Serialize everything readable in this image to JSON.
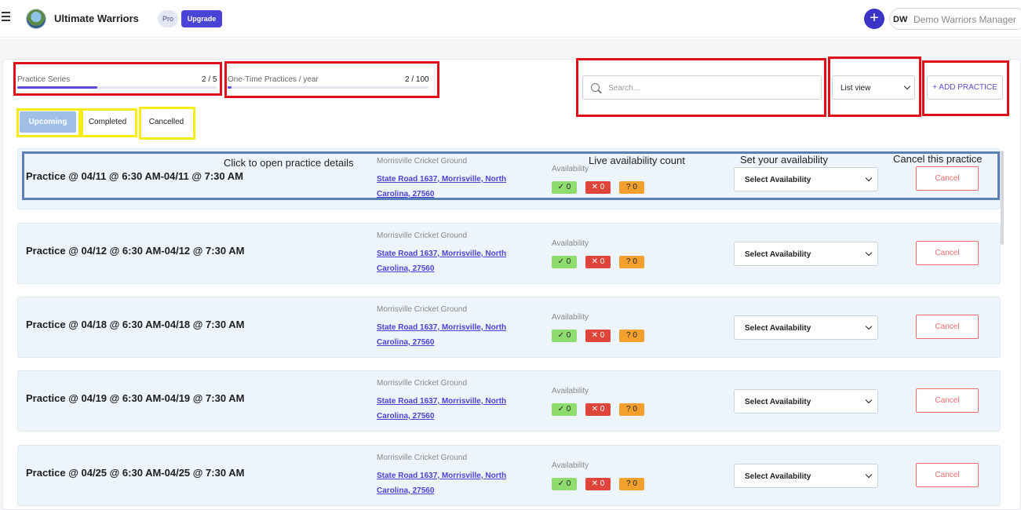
{
  "header": {
    "team_name": "Ultimate Warriors",
    "pro_badge": "Pro",
    "upgrade_label": "Upgrade",
    "add_icon": "+",
    "user_initials": "DW",
    "user_name": "Demo Warriors Manager"
  },
  "stats": {
    "practice_series": {
      "label": "Practice Series",
      "count": "2 / 5",
      "progress": 0.4
    },
    "one_time": {
      "label": "One-Time Practices / year",
      "count": "2 / 100",
      "progress": 0.02
    }
  },
  "toolbar": {
    "search_placeholder": "Search...",
    "view_select": "List view",
    "add_practice_label": "+ ADD PRACTICE"
  },
  "tabs": [
    {
      "label": "Upcoming",
      "active": true
    },
    {
      "label": "Completed",
      "active": false
    },
    {
      "label": "Cancelled",
      "active": false
    }
  ],
  "practices": [
    {
      "title": "Practice @ 04/11 @ 6:30 AM-04/11 @ 7:30 AM",
      "venue": "Morrisville Cricket Ground",
      "address_line1": "State Road 1637, Morrisville, North",
      "address_line2": "Carolina, 27560",
      "availability_label": "Availability",
      "yes": "✓ 0",
      "no": "✕ 0",
      "maybe": "? 0",
      "select_label": "Select Availability",
      "cancel_label": "Cancel"
    },
    {
      "title": "Practice @ 04/12 @ 6:30 AM-04/12 @ 7:30 AM",
      "venue": "Morrisville Cricket Ground",
      "address_line1": "State Road 1637, Morrisville, North",
      "address_line2": "Carolina, 27560",
      "availability_label": "Availability",
      "yes": "✓ 0",
      "no": "✕ 0",
      "maybe": "? 0",
      "select_label": "Select Availability",
      "cancel_label": "Cancel"
    },
    {
      "title": "Practice @ 04/18 @ 6:30 AM-04/18 @ 7:30 AM",
      "venue": "Morrisville Cricket Ground",
      "address_line1": "State Road 1637, Morrisville, North",
      "address_line2": "Carolina, 27560",
      "availability_label": "Availability",
      "yes": "✓ 0",
      "no": "✕ 0",
      "maybe": "? 0",
      "select_label": "Select Availability",
      "cancel_label": "Cancel"
    },
    {
      "title": "Practice @ 04/19 @ 6:30 AM-04/19 @ 7:30 AM",
      "venue": "Morrisville Cricket Ground",
      "address_line1": "State Road 1637, Morrisville, North",
      "address_line2": "Carolina, 27560",
      "availability_label": "Availability",
      "yes": "✓ 0",
      "no": "✕ 0",
      "maybe": "? 0",
      "select_label": "Select Availability",
      "cancel_label": "Cancel"
    },
    {
      "title": "Practice @ 04/25 @ 6:30 AM-04/25 @ 7:30 AM",
      "venue": "Morrisville Cricket Ground",
      "address_line1": "State Road 1637, Morrisville, North",
      "address_line2": "Carolina, 27560",
      "availability_label": "Availability",
      "yes": "✓ 0",
      "no": "✕ 0",
      "maybe": "? 0",
      "select_label": "Select Availability",
      "cancel_label": "Cancel"
    }
  ],
  "annotations": {
    "open_details": "Click to open practice details",
    "live_count": "Live availability count",
    "set_availability": "Set your availability",
    "cancel_practice": "Cancel this practice"
  },
  "colors": {
    "accent": "#4a43d8",
    "highlight_red": "#e0101b",
    "highlight_yellow": "#f6ec1a",
    "highlight_blue": "#5a7fb5"
  }
}
